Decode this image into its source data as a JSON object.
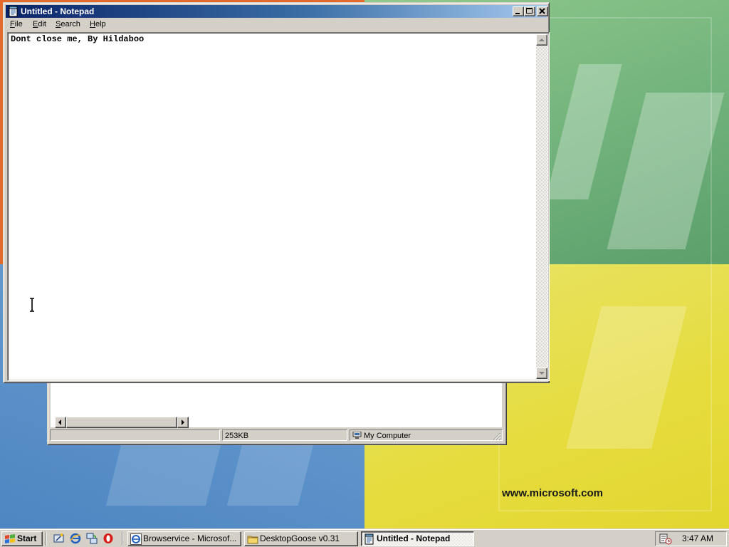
{
  "desktop": {
    "wallpaper_text": "www.microsoft.com"
  },
  "explorer_window": {
    "status_size": "253KB",
    "status_location": "My Computer"
  },
  "notepad": {
    "title": "Untitled - Notepad",
    "menu": [
      {
        "label": "File",
        "accel": "F",
        "rest": "ile"
      },
      {
        "label": "Edit",
        "accel": "E",
        "rest": "dit"
      },
      {
        "label": "Search",
        "accel": "S",
        "rest": "earch"
      },
      {
        "label": "Help",
        "accel": "H",
        "rest": "elp"
      }
    ],
    "content": "Dont close me, By Hildaboo"
  },
  "taskbar": {
    "start_label": "Start",
    "quick_launch_icons": [
      "show-desktop-icon",
      "internet-explorer-icon",
      "network-icon",
      "opera-icon"
    ],
    "tasks": [
      {
        "label": "Browservice - Microsof...",
        "icon": "internet-explorer-icon",
        "active": false
      },
      {
        "label": "DesktopGoose v0.31",
        "icon": "folder-icon",
        "active": false
      },
      {
        "label": "Untitled - Notepad",
        "icon": "notepad-icon",
        "active": true
      }
    ],
    "clock": "3:47 AM"
  },
  "colors": {
    "titlebar_active_start": "#0a246a",
    "titlebar_active_end": "#a6caf0",
    "face": "#d4d0c8"
  }
}
